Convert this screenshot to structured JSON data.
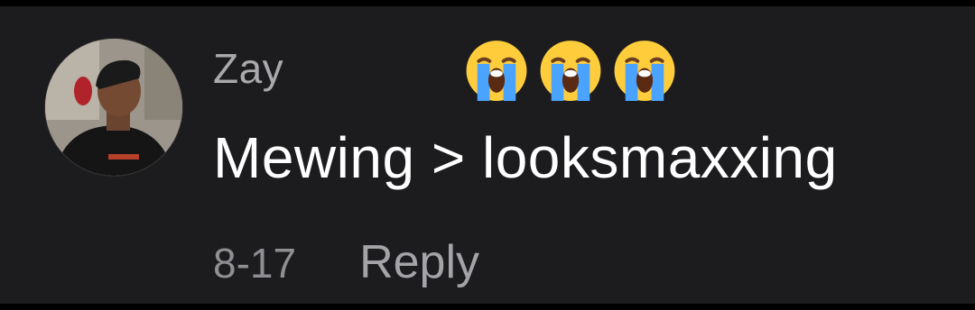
{
  "comment": {
    "username": "Zay",
    "emoji_name": "loudly-crying-face-icon",
    "emoji_count": 3,
    "text": "Mewing > looksmaxxing",
    "date": "8-17",
    "reply_label": "Reply"
  },
  "colors": {
    "background": "#1c1c1e",
    "text_primary": "#ffffff",
    "text_secondary": "#a9a9ad",
    "emoji_face": "#ffcd3c",
    "emoji_tears": "#4aa3ff"
  }
}
